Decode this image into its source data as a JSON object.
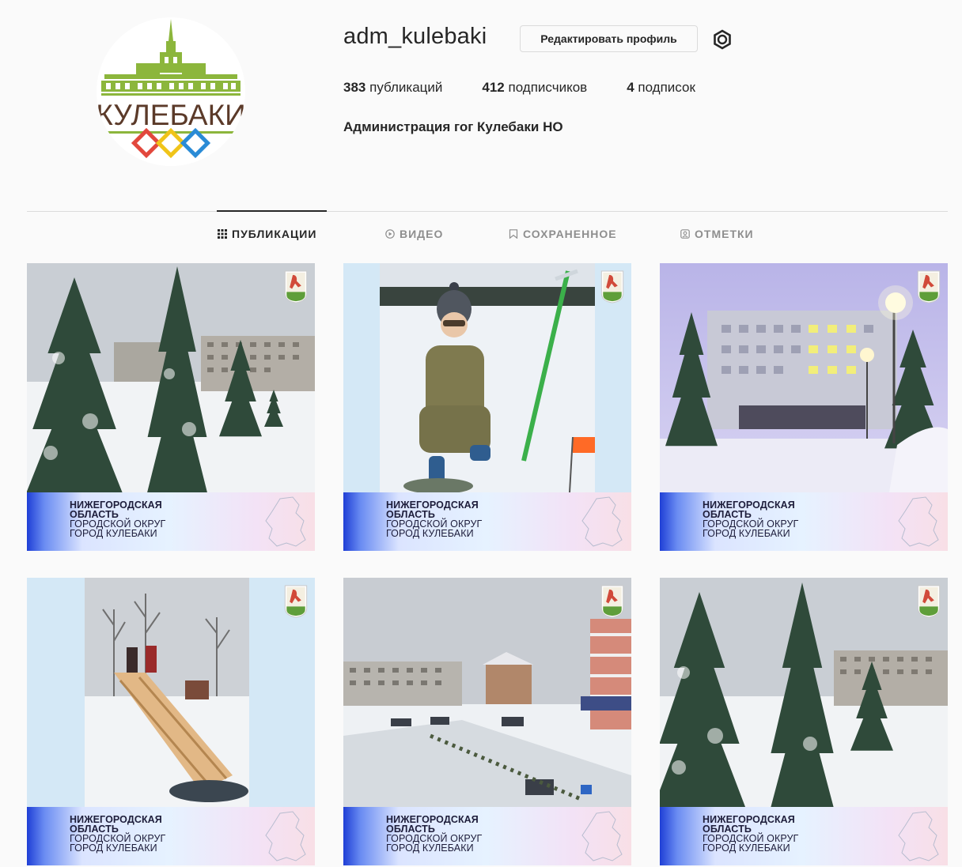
{
  "profile": {
    "username": "adm_kulebaki",
    "edit_label": "Редактировать профиль",
    "avatar_text": "КУЛЕБАКИ",
    "stats": [
      {
        "count": "383",
        "label": "публикаций"
      },
      {
        "count": "412",
        "label": "подписчиков"
      },
      {
        "count": "4",
        "label": "подписок"
      }
    ],
    "bio": "Администрация гог Кулебаки НО"
  },
  "tabs": [
    {
      "label": "ПУБЛИКАЦИИ",
      "icon": "grid-icon",
      "active": true
    },
    {
      "label": "ВИДЕО",
      "icon": "play-icon",
      "active": false
    },
    {
      "label": "СОХРАНЕННОЕ",
      "icon": "bookmark-icon",
      "active": false
    },
    {
      "label": "ОТМЕТКИ",
      "icon": "tag-icon",
      "active": false
    }
  ],
  "banner": {
    "line1": "НИЖЕГОРОДСКАЯ",
    "line2": "ОБЛАСТЬ",
    "line3": "ГОРОДСКОЙ ОКРУГ",
    "line4": "ГОРОД КУЛЕБАКИ"
  },
  "posts": [
    {
      "scene": "snowy-park-firs"
    },
    {
      "scene": "child-ice-fishing"
    },
    {
      "scene": "administration-building-evening"
    },
    {
      "scene": "wooden-ice-slide"
    },
    {
      "scene": "winter-street-aerial"
    },
    {
      "scene": "snowy-park-firs-2"
    }
  ],
  "colors": {
    "text": "#262626",
    "muted": "#8e8e8e",
    "border": "#dbdbdb",
    "background": "#fafafa",
    "logo_green": "#8cb63c",
    "logo_brown": "#5b3a29"
  }
}
